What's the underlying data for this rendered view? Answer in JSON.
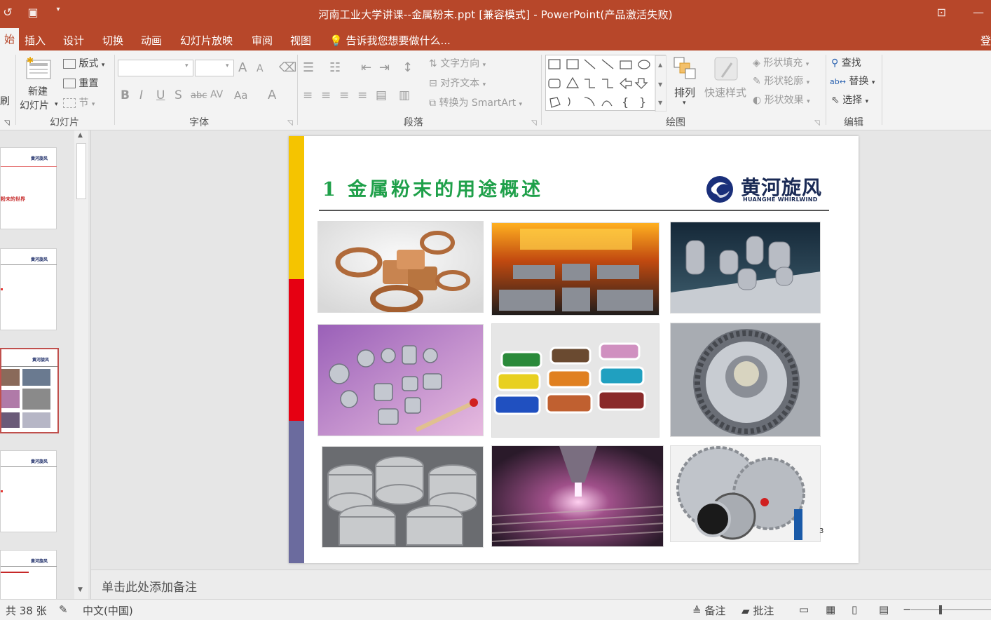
{
  "window": {
    "title": "河南工业大学讲课--金属粉末.ppt [兼容模式] - PowerPoint(产品激活失败)"
  },
  "tabs": [
    {
      "label": "始",
      "active": true
    },
    {
      "label": "插入"
    },
    {
      "label": "设计"
    },
    {
      "label": "切换"
    },
    {
      "label": "动画"
    },
    {
      "label": "幻灯片放映"
    },
    {
      "label": "审阅"
    },
    {
      "label": "视图"
    }
  ],
  "tell_me": "告诉我您想要做什么...",
  "sign_in": "登",
  "ribbon": {
    "clipboard": {
      "brush_label": "刷"
    },
    "slides": {
      "new_slide": "新建\n幻灯片",
      "new_slide_l1": "新建",
      "new_slide_l2": "幻灯片",
      "layout": "版式",
      "reset": "重置",
      "section": "节",
      "group_label": "幻灯片"
    },
    "font": {
      "group_label": "字体",
      "font_size_grow": "A",
      "font_size_shrink": "A",
      "bold": "B",
      "italic": "I",
      "underline": "U",
      "shadow": "S",
      "strike": "abc",
      "spacing": "AV",
      "case": "Aa",
      "color": "A"
    },
    "paragraph": {
      "text_direction": "文字方向",
      "align_text": "对齐文本",
      "convert_smartart": "转换为 SmartArt",
      "group_label": "段落"
    },
    "drawing": {
      "arrange": "排列",
      "quick_styles": "快速样式",
      "shape_fill": "形状填充",
      "shape_outline": "形状轮廓",
      "shape_effects": "形状效果",
      "group_label": "绘图"
    },
    "editing": {
      "find": "查找",
      "replace": "替换",
      "select": "选择",
      "group_label": "编辑"
    }
  },
  "thumbnails": [
    {
      "logo": "黄河旋风",
      "text": "粉末的世界"
    },
    {
      "logo": "黄河旋风"
    },
    {
      "logo": "黄河旋风",
      "selected": true
    },
    {
      "logo": "黄河旋风"
    },
    {
      "logo": "黄河旋风"
    }
  ],
  "slide": {
    "title": "1 金属粉末的用途概述",
    "logo_cn": "黄河旋风",
    "logo_en": "HUANGHE WHIRLWIND",
    "page_number": "3",
    "bar_colors": [
      "#f5c400",
      "#e60012",
      "#6b6b9e"
    ],
    "images": [
      "copper-bushings-photo",
      "sintering-furnace-photo",
      "3d-printed-lattice-photo",
      "metal-parts-photo",
      "colored-powders-photo",
      "gear-ring-photo",
      "wire-spools-photo",
      "laser-cladding-photo",
      "diamond-saw-blades-photo"
    ]
  },
  "notes": {
    "placeholder": "单击此处添加备注"
  },
  "status": {
    "slide_count": "共 38 张",
    "language": "中文(中国)",
    "notes_btn": "备注",
    "comments_btn": "批注"
  }
}
